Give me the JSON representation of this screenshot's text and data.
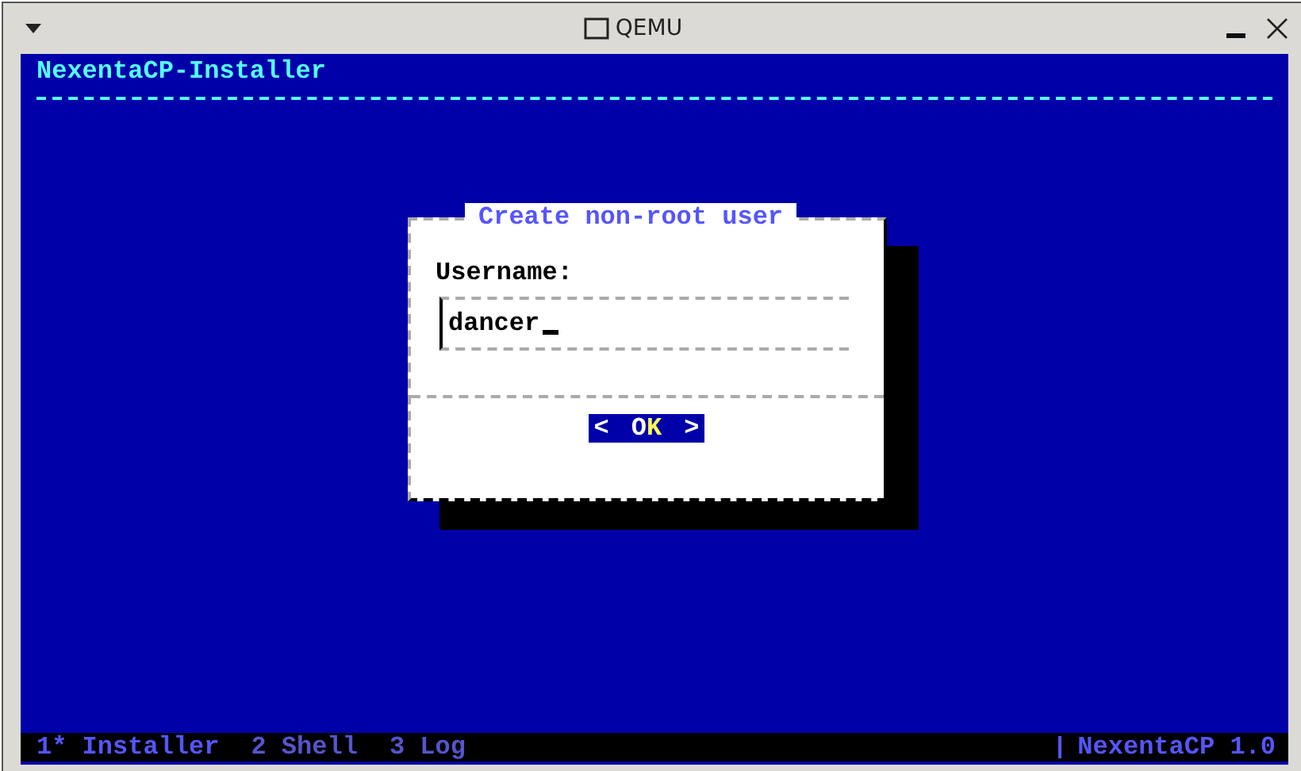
{
  "window": {
    "title": "QEMU"
  },
  "screen": {
    "header": "NexentaCP-Installer"
  },
  "dialog": {
    "title": "Create non-root user",
    "field_label": "Username:",
    "field_value": "dancer",
    "button": {
      "left": "<",
      "right": ">",
      "label_parts": [
        {
          "text": "O",
          "hotkey": false
        },
        {
          "text": "K",
          "hotkey": true
        }
      ],
      "selected": true
    }
  },
  "status_bar": {
    "tabs": [
      {
        "label": "1* Installer",
        "selected": true
      },
      {
        "label": "2 Shell",
        "selected": false
      },
      {
        "label": "3 Log",
        "selected": false
      }
    ],
    "right": "NexentaCP 1.0"
  }
}
